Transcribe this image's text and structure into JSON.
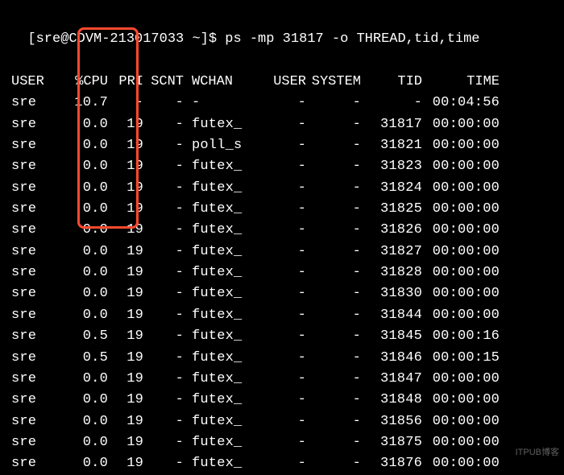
{
  "prompt": {
    "user_host": "[sre@CDVM-213017033 ~]$",
    "command": "ps -mp 31817 -o THREAD,tid,time"
  },
  "headers": {
    "user": "USER",
    "cpu": "%CPU",
    "pri": "PRI",
    "scnt": "SCNT",
    "wchan": "WCHAN",
    "user2": "USER",
    "system": "SYSTEM",
    "tid": "TID",
    "time": "TIME"
  },
  "rows": [
    {
      "user": "sre",
      "cpu": "10.7",
      "pri": "-",
      "scnt": "-",
      "wchan": "-",
      "user2": "-",
      "system": "-",
      "tid": "-",
      "time": "00:04:56"
    },
    {
      "user": "sre",
      "cpu": "0.0",
      "pri": "19",
      "scnt": "-",
      "wchan": "futex_",
      "user2": "-",
      "system": "-",
      "tid": "31817",
      "time": "00:00:00"
    },
    {
      "user": "sre",
      "cpu": "0.0",
      "pri": "19",
      "scnt": "-",
      "wchan": "poll_s",
      "user2": "-",
      "system": "-",
      "tid": "31821",
      "time": "00:00:00"
    },
    {
      "user": "sre",
      "cpu": "0.0",
      "pri": "19",
      "scnt": "-",
      "wchan": "futex_",
      "user2": "-",
      "system": "-",
      "tid": "31823",
      "time": "00:00:00"
    },
    {
      "user": "sre",
      "cpu": "0.0",
      "pri": "19",
      "scnt": "-",
      "wchan": "futex_",
      "user2": "-",
      "system": "-",
      "tid": "31824",
      "time": "00:00:00"
    },
    {
      "user": "sre",
      "cpu": "0.0",
      "pri": "19",
      "scnt": "-",
      "wchan": "futex_",
      "user2": "-",
      "system": "-",
      "tid": "31825",
      "time": "00:00:00"
    },
    {
      "user": "sre",
      "cpu": "0.0",
      "pri": "19",
      "scnt": "-",
      "wchan": "futex_",
      "user2": "-",
      "system": "-",
      "tid": "31826",
      "time": "00:00:00"
    },
    {
      "user": "sre",
      "cpu": "0.0",
      "pri": "19",
      "scnt": "-",
      "wchan": "futex_",
      "user2": "-",
      "system": "-",
      "tid": "31827",
      "time": "00:00:00"
    },
    {
      "user": "sre",
      "cpu": "0.0",
      "pri": "19",
      "scnt": "-",
      "wchan": "futex_",
      "user2": "-",
      "system": "-",
      "tid": "31828",
      "time": "00:00:00"
    },
    {
      "user": "sre",
      "cpu": "0.0",
      "pri": "19",
      "scnt": "-",
      "wchan": "futex_",
      "user2": "-",
      "system": "-",
      "tid": "31830",
      "time": "00:00:00"
    },
    {
      "user": "sre",
      "cpu": "0.0",
      "pri": "19",
      "scnt": "-",
      "wchan": "futex_",
      "user2": "-",
      "system": "-",
      "tid": "31844",
      "time": "00:00:00"
    },
    {
      "user": "sre",
      "cpu": "0.5",
      "pri": "19",
      "scnt": "-",
      "wchan": "futex_",
      "user2": "-",
      "system": "-",
      "tid": "31845",
      "time": "00:00:16"
    },
    {
      "user": "sre",
      "cpu": "0.5",
      "pri": "19",
      "scnt": "-",
      "wchan": "futex_",
      "user2": "-",
      "system": "-",
      "tid": "31846",
      "time": "00:00:15"
    },
    {
      "user": "sre",
      "cpu": "0.0",
      "pri": "19",
      "scnt": "-",
      "wchan": "futex_",
      "user2": "-",
      "system": "-",
      "tid": "31847",
      "time": "00:00:00"
    },
    {
      "user": "sre",
      "cpu": "0.0",
      "pri": "19",
      "scnt": "-",
      "wchan": "futex_",
      "user2": "-",
      "system": "-",
      "tid": "31848",
      "time": "00:00:00"
    },
    {
      "user": "sre",
      "cpu": "0.0",
      "pri": "19",
      "scnt": "-",
      "wchan": "futex_",
      "user2": "-",
      "system": "-",
      "tid": "31856",
      "time": "00:00:00"
    },
    {
      "user": "sre",
      "cpu": "0.0",
      "pri": "19",
      "scnt": "-",
      "wchan": "futex_",
      "user2": "-",
      "system": "-",
      "tid": "31875",
      "time": "00:00:00"
    },
    {
      "user": "sre",
      "cpu": "0.0",
      "pri": "19",
      "scnt": "-",
      "wchan": "futex_",
      "user2": "-",
      "system": "-",
      "tid": "31876",
      "time": "00:00:00"
    }
  ],
  "watermark": "ITPUB博客"
}
